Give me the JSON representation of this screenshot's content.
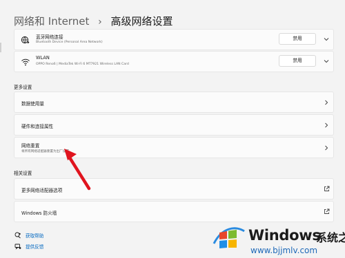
{
  "breadcrumb": {
    "parent": "网络和 Internet",
    "separator": "›",
    "current": "高级网络设置"
  },
  "adapters": [
    {
      "icon": "bluetooth-network-icon",
      "name": "蓝牙网络连接",
      "description": "Bluetooth Device (Personal Area Network)",
      "button": "禁用"
    },
    {
      "icon": "wifi-icon",
      "name": "WLAN",
      "description": "OPPO Reno6 | MediaTek Wi-Fi 6 MT7921 Wireless LAN Card",
      "button": "禁用"
    }
  ],
  "more_settings": {
    "header": "更多设置",
    "items": [
      {
        "label": "数据使用量"
      },
      {
        "label": "硬件和连接属性"
      },
      {
        "label": "网络重置",
        "sublabel": "将所有网络适配器重置为出厂设置"
      }
    ]
  },
  "related_settings": {
    "header": "相关设置",
    "items": [
      {
        "label": "更多网络适配器选项"
      },
      {
        "label": "Windows 防火墙"
      }
    ]
  },
  "footer": {
    "help": "获取帮助",
    "feedback": "提供反馈"
  },
  "watermark": {
    "brand": "Windows",
    "brand_cn": "系统之家",
    "url": "www.bjjmlv.com"
  },
  "colors": {
    "accent": "#0067c0",
    "arrow": "#e0141e",
    "background": "#f3f3f3",
    "card": "#fbfbfb"
  }
}
